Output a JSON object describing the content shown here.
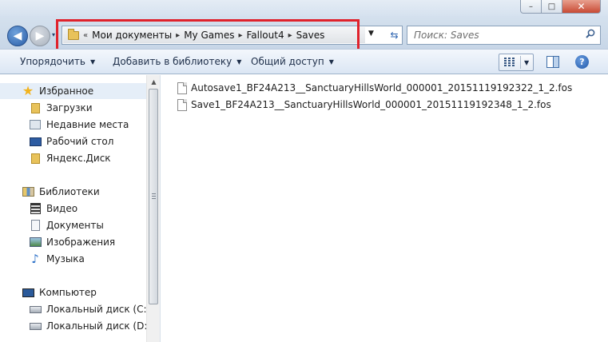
{
  "window": {
    "caption_buttons": {
      "minimize": "–",
      "maximize": "□",
      "close": "✕"
    }
  },
  "nav": {
    "back": "◀",
    "forward": "▶",
    "history_drop": "▾"
  },
  "address": {
    "root_chevron": "«",
    "crumbs": [
      "Мои документы",
      "My Games",
      "Fallout4",
      "Saves"
    ],
    "separator": "▸",
    "dropdown": "▼",
    "refresh": "⇆"
  },
  "search": {
    "placeholder": "Поиск: Saves"
  },
  "toolbar": {
    "organize": "Упорядочить",
    "add_to_library": "Добавить в библиотеку",
    "share": "Общий доступ",
    "dropdown_arrow": "▼",
    "help": "?"
  },
  "sidebar": {
    "favorites": {
      "label": "Избранное",
      "items": [
        "Загрузки",
        "Недавние места",
        "Рабочий стол",
        "Яндекс.Диск"
      ]
    },
    "libraries": {
      "label": "Библиотеки",
      "items": [
        "Видео",
        "Документы",
        "Изображения",
        "Музыка"
      ]
    },
    "computer": {
      "label": "Компьютер",
      "items": [
        "Локальный диск (C:)",
        "Локальный диск (D:)"
      ]
    },
    "scroll_up": "▲"
  },
  "files": [
    "Autosave1_BF24A213__SanctuaryHillsWorld_000001_20151119192322_1_2.fos",
    "Save1_BF24A213__SanctuaryHillsWorld_000001_20151119192348_1_2.fos"
  ],
  "colors": {
    "highlight_box": "#e0222c",
    "accent": "#2b5ea7"
  }
}
